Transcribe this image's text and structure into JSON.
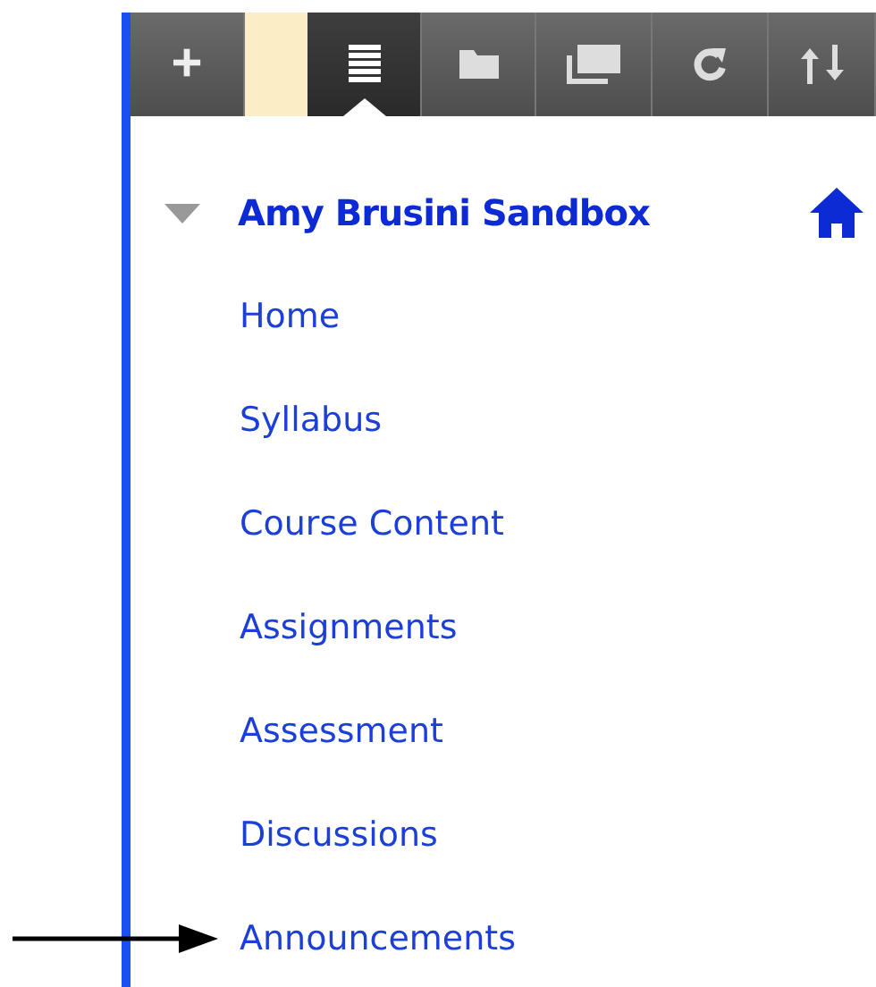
{
  "toolbar": [
    {
      "kind": "add",
      "label": "+",
      "selected": false
    },
    {
      "kind": "blank",
      "selected": false
    },
    {
      "kind": "list",
      "selected": true
    },
    {
      "kind": "folder",
      "selected": false
    },
    {
      "kind": "windows",
      "selected": false
    },
    {
      "kind": "refresh",
      "selected": false
    },
    {
      "kind": "sort",
      "selected": false
    }
  ],
  "course": {
    "title": "Amy Brusini Sandbox",
    "expanded": true
  },
  "menu_items": [
    {
      "label": "Home"
    },
    {
      "label": "Syllabus"
    },
    {
      "label": "Course Content"
    },
    {
      "label": "Assignments"
    },
    {
      "label": "Assessment"
    },
    {
      "label": "Discussions"
    },
    {
      "label": "Announcements",
      "pointed": true
    }
  ]
}
